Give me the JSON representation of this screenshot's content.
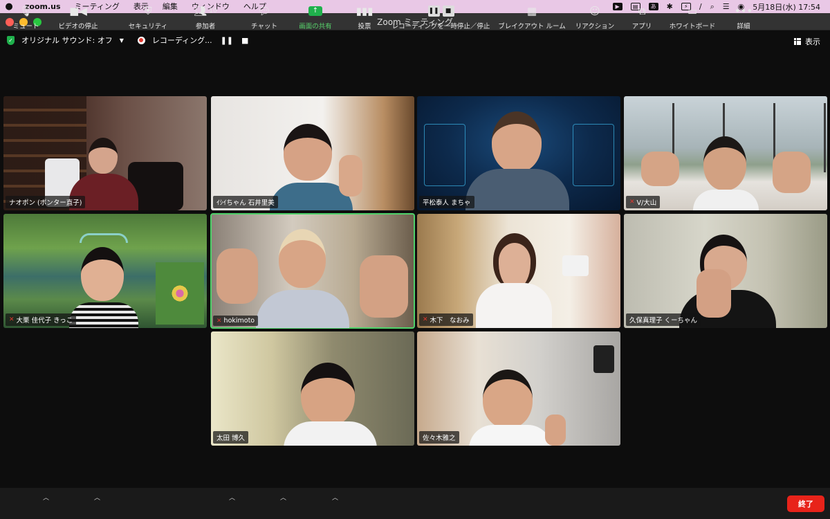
{
  "menubar": {
    "app": "zoom.us",
    "items": [
      "ミーティング",
      "表示",
      "編集",
      "ウィンドウ",
      "ヘルプ"
    ],
    "datetime": "5月18日(水)  17:54",
    "input_char": "あ"
  },
  "window": {
    "title": "Zoom ミーティング"
  },
  "topbar": {
    "audio_label": "オリジナル サウンド: オフ",
    "recording_label": "レコーディング...",
    "view_label": "表示"
  },
  "participants": [
    {
      "name": "ナオポン (ポンター直子)",
      "muted": false,
      "active": false
    },
    {
      "name": "ｲｼｲちゃん 石井里美",
      "muted": false,
      "active": false
    },
    {
      "name": "平松泰人 まちゃ",
      "muted": false,
      "active": false
    },
    {
      "name": "V/大山",
      "muted": true,
      "active": false
    },
    {
      "name": "大栗 佳代子 きっこ",
      "muted": true,
      "active": false
    },
    {
      "name": "hokimoto",
      "muted": true,
      "active": true
    },
    {
      "name": "木下　なおみ",
      "muted": true,
      "active": false
    },
    {
      "name": "久保真理子 くーちゃん",
      "muted": false,
      "active": false
    },
    {
      "name": "太田 博久",
      "muted": false,
      "active": false
    },
    {
      "name": "佐々木雅之",
      "muted": false,
      "active": false
    }
  ],
  "toolbar": {
    "mute": "ミュート",
    "video": "ビデオの停止",
    "security": "セキュリティ",
    "participants": "参加者",
    "participants_count": "10",
    "chat": "チャット",
    "share": "画面の共有",
    "poll": "投票",
    "recording": "レコーディングを一時停止／停止",
    "breakout": "ブレイクアウト ルーム",
    "reaction": "リアクション",
    "apps": "アプリ",
    "whiteboard": "ホワイトボード",
    "more": "詳細",
    "end": "終了"
  },
  "colors": {
    "active_outline": "#4fd26a",
    "mute_red": "#e0382f",
    "end_red": "#e8231a",
    "share_green": "#1fb14c"
  }
}
